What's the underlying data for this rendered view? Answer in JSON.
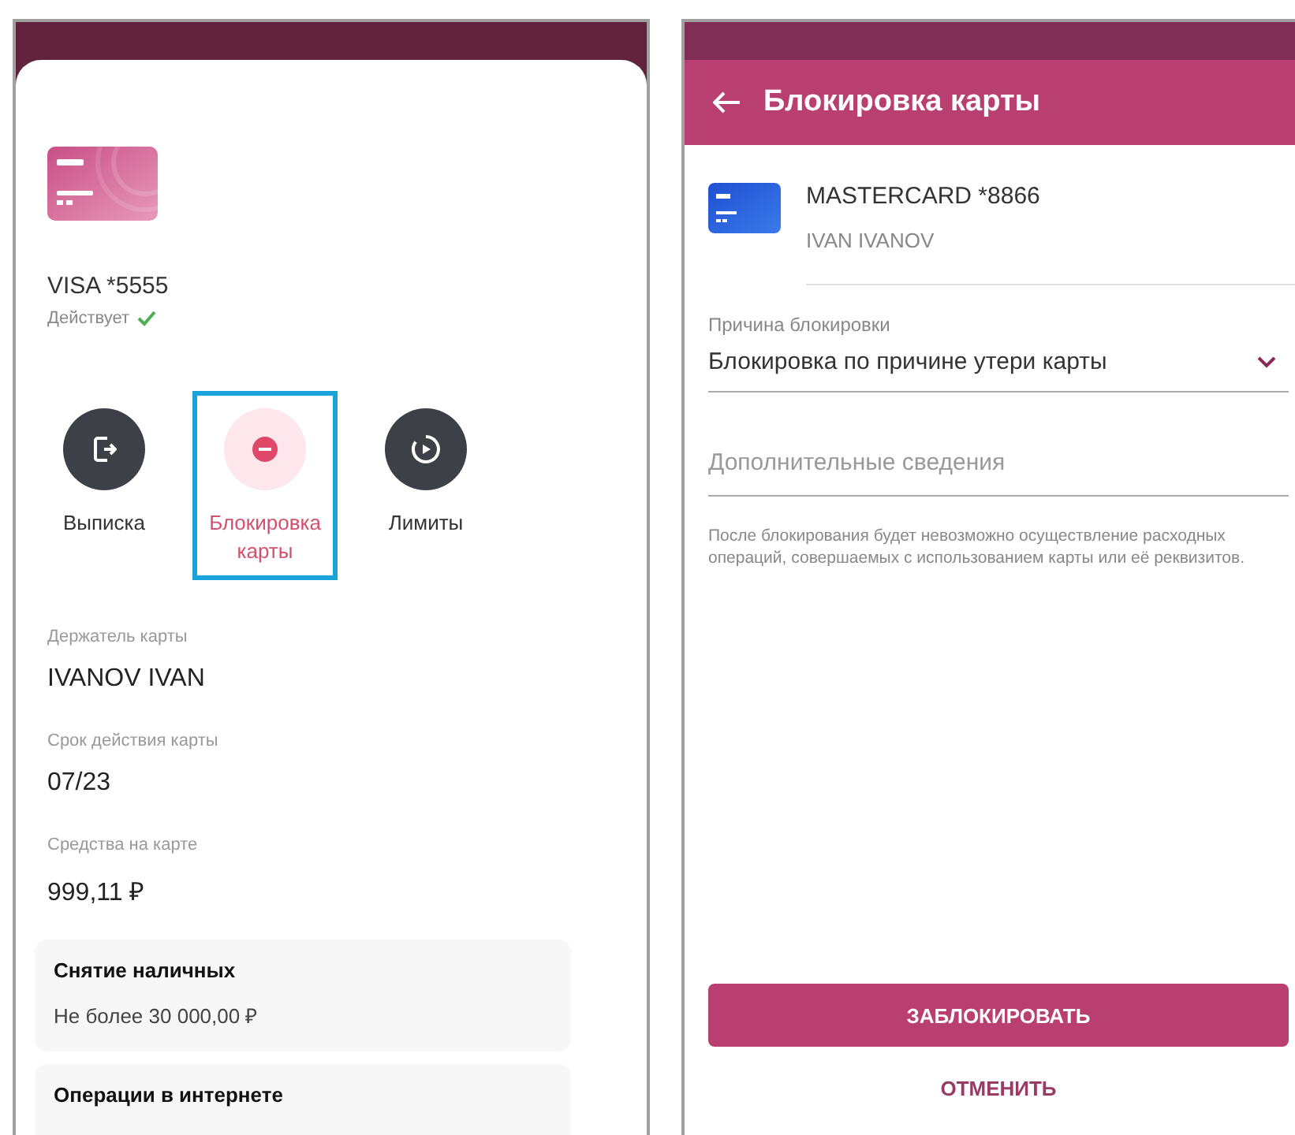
{
  "left": {
    "card": {
      "title": "VISA *5555",
      "status": "Действует",
      "active": true
    },
    "actions": [
      {
        "label": "Выписка",
        "kind": "statement",
        "selected": false
      },
      {
        "label": "Блокировка карты",
        "kind": "block",
        "selected": true
      },
      {
        "label": "Лимиты",
        "kind": "limits",
        "selected": false
      }
    ],
    "details": [
      {
        "label": "Держатель карты",
        "value": "IVANOV IVAN"
      },
      {
        "label": "Срок действия карты",
        "value": "07/23"
      },
      {
        "label": "Средства на карте",
        "value": "999,11 ₽"
      }
    ],
    "limits": [
      {
        "title": "Снятие наличных",
        "value": "Не более 30 000,00 ₽"
      },
      {
        "title": "Операции в интернете"
      }
    ]
  },
  "right": {
    "header": {
      "title": "Блокировка карты"
    },
    "card": {
      "name": "MASTERCARD *8866",
      "holder": "IVAN IVANOV"
    },
    "reason_field": {
      "label": "Причина блокировки",
      "value": "Блокировка по причине утери карты"
    },
    "details_field": {
      "placeholder": "Дополнительные сведения"
    },
    "note": "После блокирования будет невозможно осуществление расходных операций, совершаемых с использованием карты или её реквизитов.",
    "buttons": [
      {
        "label": "ЗАБЛОКИРОВАТЬ",
        "kind": "primary"
      },
      {
        "label": "ОТМЕНИТЬ",
        "kind": "text"
      }
    ]
  }
}
